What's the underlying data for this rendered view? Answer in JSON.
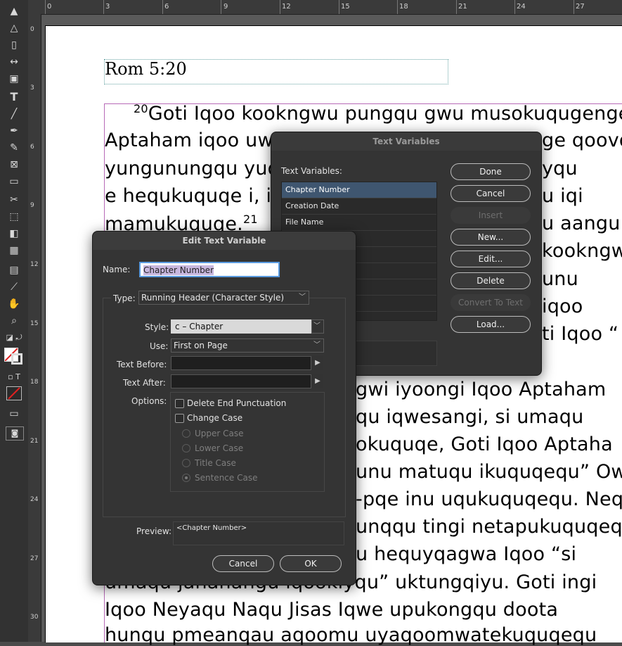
{
  "ruler": {
    "h": [
      "0",
      "3",
      "6",
      "9",
      "12",
      "15",
      "18",
      "21",
      "24",
      "27"
    ],
    "v": [
      "0",
      "3",
      "6",
      "9",
      "12",
      "15",
      "18",
      "21",
      "24",
      "27",
      "30"
    ]
  },
  "tools": [
    "selection-arrow",
    "direct-selection",
    "page-tool",
    "gap-tool",
    "content-collector",
    "type-tool",
    "line-tool",
    "pen-tool",
    "pencil-tool",
    "rectangle-frame",
    "rectangle",
    "scissors",
    "free-transform",
    "gradient-swatch",
    "gradient-feather",
    "note-tool",
    "eyedropper",
    "hand-tool",
    "zoom-tool"
  ],
  "document": {
    "running_header": "Rom 5:20",
    "lines": [
      {
        "sup": "20",
        "text": "Goti Iqoo kookngwu pungqu gwu musokuqugenge"
      },
      {
        "text": "Aptaham iqoo uw"
      },
      {
        "text": "yungunungqu yuq"
      },
      {
        "text": "e hequkuquqe i, i"
      },
      {
        "text": "mamukuquqe.",
        "sup": "21"
      },
      {
        "text": "gwi iyoongi Iqoo Aptaham"
      },
      {
        "text": "qu iqwesangi, si umaqu"
      },
      {
        "text": "okuquqe, Goti Iqoo Aptaha"
      },
      {
        "text": "unu matuqu ikuquqequ” Ow"
      },
      {
        "text": "-pqe inu uqukuquqequ. Neq"
      },
      {
        "text": "unqqu tingi netapukuquqeq"
      },
      {
        "text": "u hequyqagwa Iqoo “si"
      },
      {
        "text": "umaqu jananangu iqookiyqu” uktungqiyu. Goti ingi"
      },
      {
        "text": "Iqoo Neyaqu Naqu Jisas Iqwe upukongqu doota"
      },
      {
        "text": "hunqu pmeanqau aqoomu uyaqoomwatekuquqequ"
      }
    ],
    "right_frags": [
      {
        "text": "ge qoovq"
      },
      {
        "text": "yqu"
      },
      {
        "text": "u iqi"
      },
      {
        "text": "u aangu"
      },
      {
        "text": "kookngw"
      },
      {
        "text": "unu"
      },
      {
        "text": "iqoo"
      },
      {
        "text": "ti Iqoo “"
      }
    ]
  },
  "text_variables_dialog": {
    "title": "Text Variables",
    "list_label": "Text Variables:",
    "items": [
      "Chapter Number",
      "Creation Date",
      "File Name",
      "",
      "",
      "",
      "",
      "",
      ""
    ],
    "selected": "Chapter Number",
    "buttons": {
      "done": "Done",
      "cancel": "Cancel",
      "insert": "Insert",
      "new": "New...",
      "edit": "Edit...",
      "delete": "Delete",
      "convert": "Convert To Text",
      "load": "Load..."
    }
  },
  "edit_dialog": {
    "title": "Edit Text Variable",
    "name_label": "Name:",
    "name_value": "Chapter Number",
    "type_label": "Type:",
    "type_value": "Running Header (Character Style)",
    "style_label": "Style:",
    "style_value": "c – Chapter",
    "use_label": "Use:",
    "use_value": "First on Page",
    "text_before_label": "Text Before:",
    "text_after_label": "Text After:",
    "options_label": "Options:",
    "delete_end_punct": "Delete End Punctuation",
    "change_case": "Change Case",
    "upper_case": "Upper Case",
    "lower_case": "Lower Case",
    "title_case": "Title Case",
    "sentence_case": "Sentence Case",
    "preview_label": "Preview:",
    "preview_value": "<Chapter Number>",
    "cancel": "Cancel",
    "ok": "OK"
  },
  "colors": {
    "selection": "#3f5670",
    "name_highlight": "#c8b7df",
    "focus_ring": "#5a9be0",
    "frame_edge": "#b76ab7"
  }
}
